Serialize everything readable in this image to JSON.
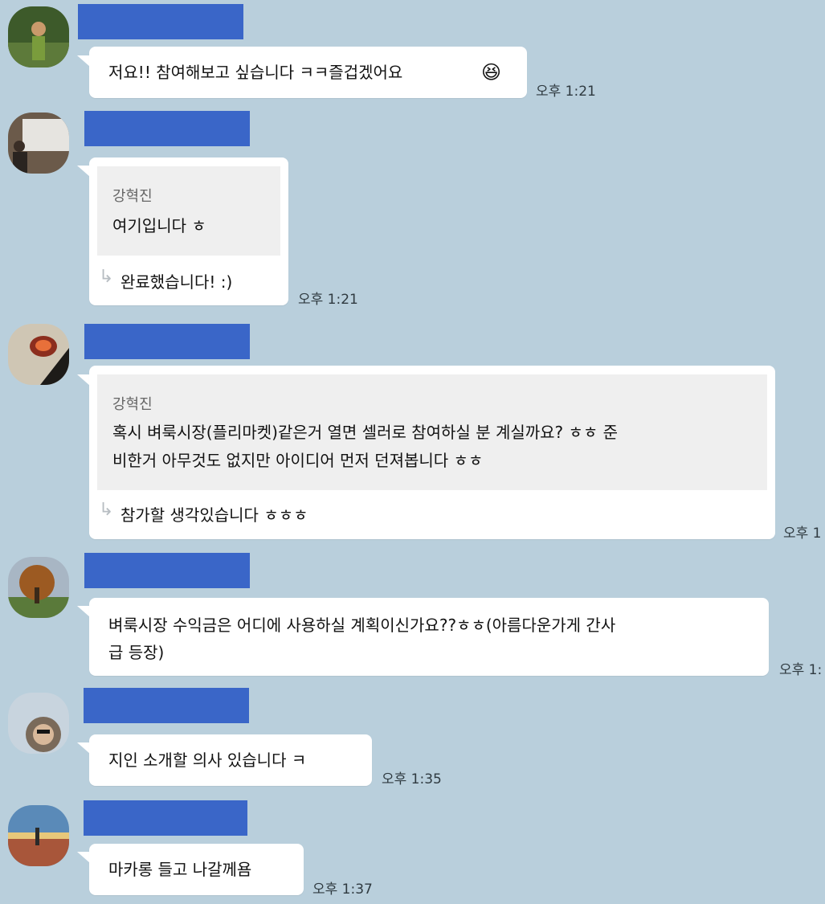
{
  "messages": [
    {
      "text": "저요!! 참여해보고 싶습니다 ㅋㅋ즐겁겠어요",
      "emoji": "😆",
      "time": "오후 1:21"
    },
    {
      "quote_author": "강혁진",
      "quote_text": "여기입니다 ㅎ",
      "reply": "완료했습니다! :)",
      "time": "오후 1:21"
    },
    {
      "quote_author": "강혁진",
      "quote_text": "혹시 벼룩시장(플리마켓)같은거 열면 셀러로 참여하실 분 계실까요? ㅎㅎ 준비한거 아무것도 없지만 아이디어 먼저 던져봅니다 ㅎㅎ",
      "quote_line1": "혹시 벼룩시장(플리마켓)같은거 열면 셀러로 참여하실 분 계실까요? ㅎㅎ 준",
      "quote_line2": "비한거 아무것도 없지만 아이디어 먼저 던져봅니다 ㅎㅎ",
      "reply": "참가할 생각있습니다 ㅎㅎㅎ",
      "time": "오후 1"
    },
    {
      "line1": "벼룩시장 수익금은 어디에 사용하실 계획이신가요??ㅎㅎ(아름다운가게 간사",
      "line2": "급 등장)",
      "time": "오후 1:"
    },
    {
      "text": "지인 소개할 의사 있습니다 ㅋ",
      "time": "오후 1:35"
    },
    {
      "text": "마카롱 들고 나갈께욤",
      "time": "오후 1:37"
    }
  ],
  "colors": {
    "background": "#b9cfdc",
    "name_redaction": "#3a66c8",
    "bubble": "#ffffff",
    "quote_bg": "#efefef"
  },
  "icons": {
    "reply": "reply-arrow-icon"
  }
}
